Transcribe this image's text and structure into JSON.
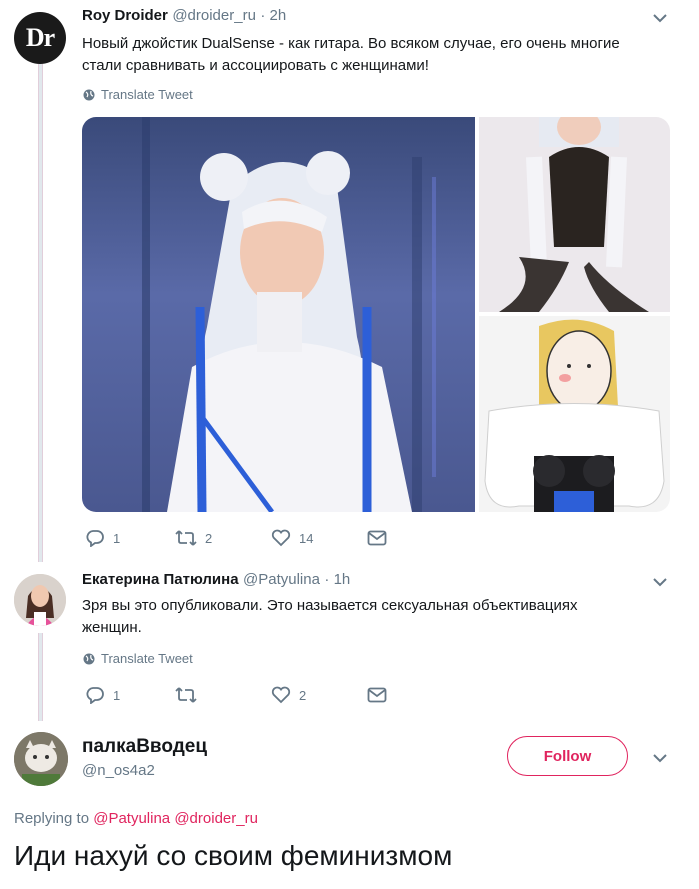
{
  "tweet1": {
    "avatar_text": "Dr",
    "name": "Roy Droider",
    "handle": "@droider_ru",
    "time": "· 2h",
    "text_line1": "Новый джойстик DualSense - как гитара. Во всяком случае, его очень многие",
    "text_line2": "стали сравнивать и ассоциировать с женщинами!",
    "translate": "Translate Tweet",
    "replies": "1",
    "retweets": "2",
    "likes": "14"
  },
  "tweet2": {
    "name": "Екатерина Патюлина",
    "handle": "@Patyulina",
    "time": "· 1h",
    "text_line1": "Зря вы это опубликовали. Это называется сексуальная объективациях",
    "text_line2": "женщин.",
    "translate": "Translate Tweet",
    "replies": "1",
    "retweets": "",
    "likes": "2"
  },
  "tweet3": {
    "name": "палкаВводец",
    "handle": "@n_os4a2",
    "follow_label": "Follow",
    "replying_prefix": "Replying to",
    "replying_user1": "@Patyulina",
    "replying_user2": "@droider_ru",
    "text": "Иди нахуй со своим феминизмом"
  },
  "colors": {
    "accent": "#e0245e",
    "secondary_text": "#657786",
    "primary_text": "#14171a"
  }
}
